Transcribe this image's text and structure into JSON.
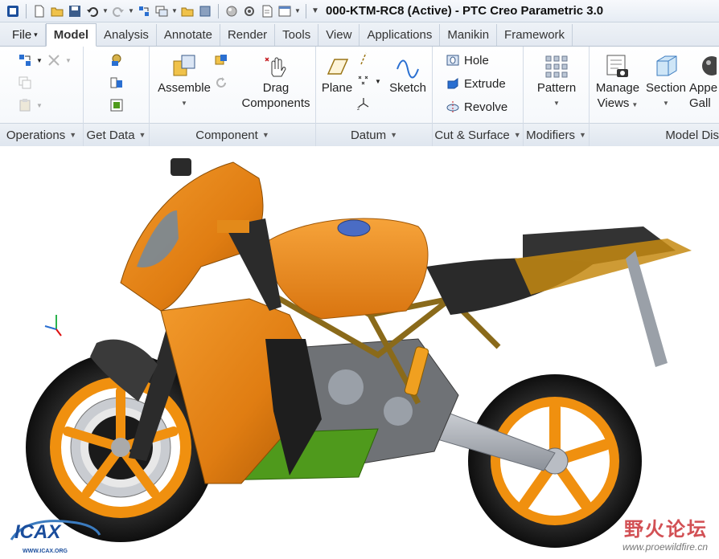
{
  "window": {
    "title": "000-KTM-RC8 (Active) - PTC Creo Parametric 3.0"
  },
  "tabs": [
    {
      "label": "File",
      "dropdown": true
    },
    {
      "label": "Model",
      "active": true
    },
    {
      "label": "Analysis"
    },
    {
      "label": "Annotate"
    },
    {
      "label": "Render"
    },
    {
      "label": "Tools"
    },
    {
      "label": "View"
    },
    {
      "label": "Applications"
    },
    {
      "label": "Manikin"
    },
    {
      "label": "Framework"
    }
  ],
  "ribbon": {
    "groups": {
      "operations": "Operations",
      "get_data": "Get Data",
      "component": "Component",
      "datum": "Datum",
      "cut_surface": "Cut & Surface",
      "modifiers": "Modifiers",
      "model_display": "Model Dis"
    },
    "buttons": {
      "assemble": "Assemble",
      "drag_line1": "Drag",
      "drag_line2": "Components",
      "plane": "Plane",
      "sketch": "Sketch",
      "hole": "Hole",
      "extrude": "Extrude",
      "revolve": "Revolve",
      "pattern": "Pattern",
      "manage_views_line1": "Manage",
      "manage_views_line2": "Views",
      "section": "Section",
      "appearance_line1": "Appe",
      "appearance_line2": "Gall"
    }
  },
  "watermarks": {
    "left_logo": "ICAX",
    "left_url": "WWW.ICAX.ORG",
    "right_text": "野火论坛",
    "right_url": "www.proewildfire.cn"
  },
  "colors": {
    "fairing": "#e07d12",
    "wheel": "#f0900f",
    "tire": "#1a1a1a",
    "belly_pan": "#4f9a1c",
    "frame": "#8a6a1a",
    "accent_blue": "#2a6fd1"
  }
}
